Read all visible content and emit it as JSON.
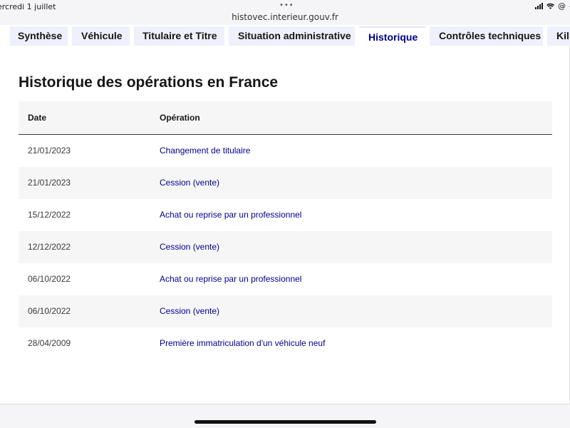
{
  "status_bar": {
    "time": "ercredi 1 juillet",
    "multitask": "•••",
    "battery": "4"
  },
  "browser": {
    "url": "histovec.interieur.gouv.fr"
  },
  "tabs": [
    {
      "label": "Synthèse",
      "active": false
    },
    {
      "label": "Véhicule",
      "active": false
    },
    {
      "label": "Titulaire et Titre",
      "active": false
    },
    {
      "label": "Situation administrative",
      "active": false
    },
    {
      "label": "Historique",
      "active": true
    },
    {
      "label": "Contrôles techniques",
      "active": false
    },
    {
      "label": "Kil",
      "active": false
    }
  ],
  "main": {
    "title": "Historique des opérations en France",
    "table": {
      "headers": {
        "date": "Date",
        "operation": "Opération"
      },
      "rows": [
        {
          "date": "21/01/2023",
          "operation": "Changement de titulaire"
        },
        {
          "date": "21/01/2023",
          "operation": "Cession (vente)"
        },
        {
          "date": "15/12/2022",
          "operation": "Achat ou reprise par un professionnel"
        },
        {
          "date": "12/12/2022",
          "operation": "Cession (vente)"
        },
        {
          "date": "06/10/2022",
          "operation": "Achat ou reprise par un professionnel"
        },
        {
          "date": "06/10/2022",
          "operation": "Cession (vente)"
        },
        {
          "date": "28/04/2009",
          "operation": "Première immatriculation d'un véhicule neuf"
        }
      ]
    }
  },
  "colors": {
    "link": "#000091",
    "tab_bg": "#eef0fb",
    "row_alt": "#f6f6f6"
  }
}
